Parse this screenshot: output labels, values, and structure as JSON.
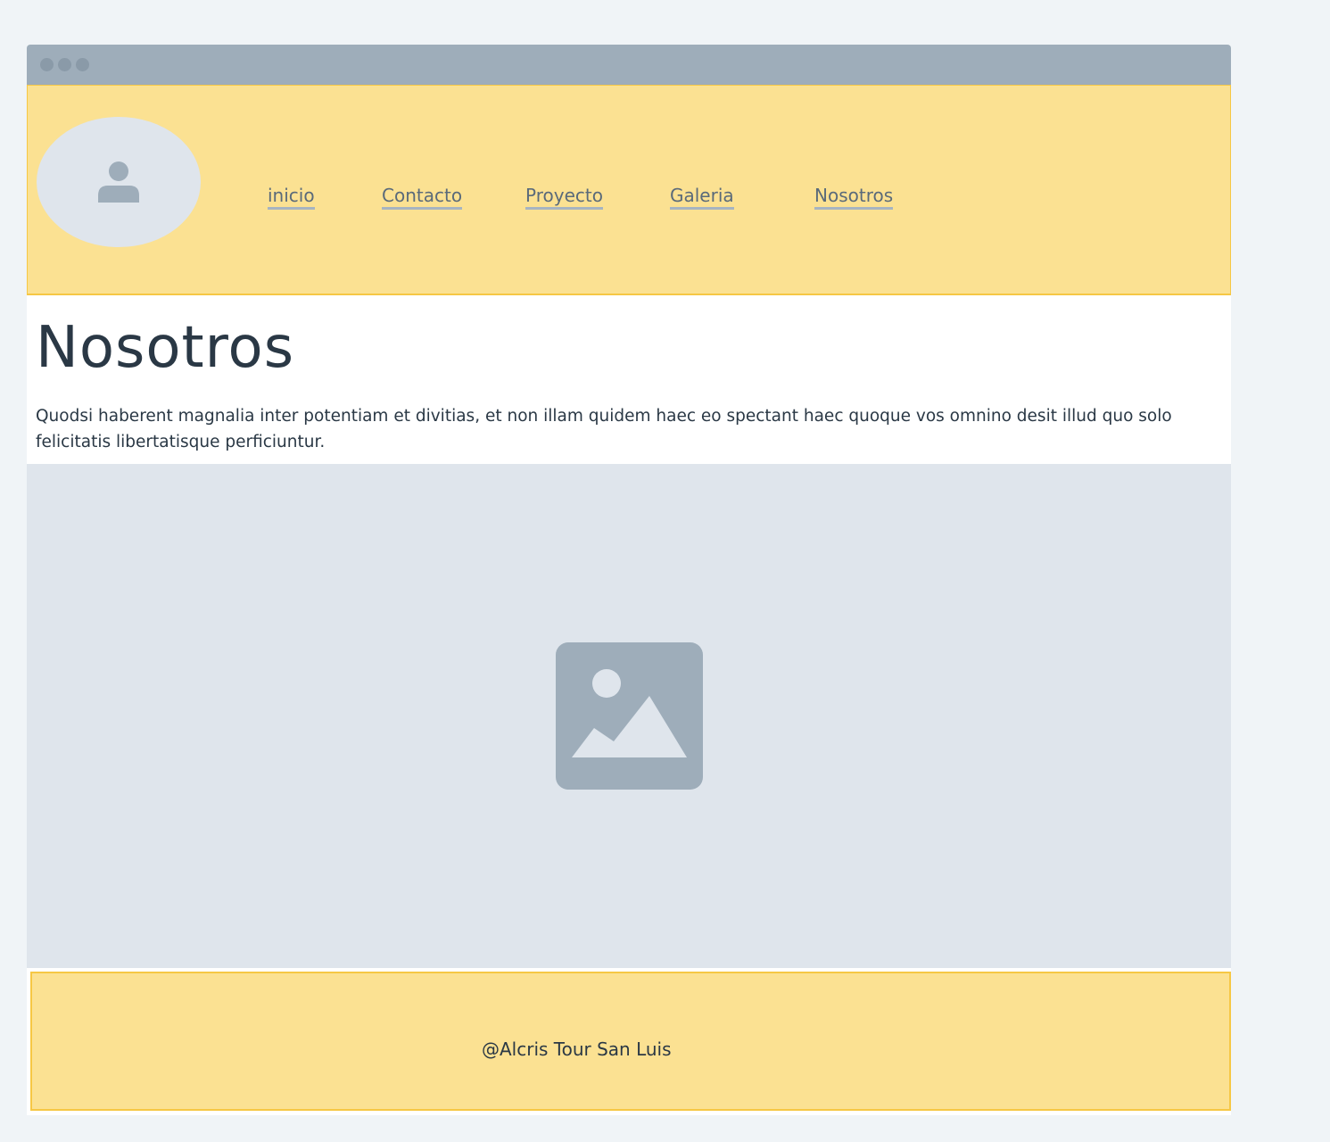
{
  "nav": {
    "items": [
      {
        "label": "inicio"
      },
      {
        "label": "Contacto"
      },
      {
        "label": "Proyecto"
      },
      {
        "label": "Galeria"
      },
      {
        "label": "Nosotros"
      }
    ]
  },
  "main": {
    "title": "Nosotros",
    "text": "Quodsi haberent magnalia inter potentiam et divitias, et non illam quidem haec eo spectant haec quoque vos omnino desit illud quo solo felicitatis libertatisque perficiuntur."
  },
  "footer": {
    "text": "@Alcris Tour San Luis"
  },
  "icons": {
    "avatar": "user-icon",
    "image": "image-icon"
  },
  "colors": {
    "header_bg": "#fbe192",
    "header_border": "#f6c744",
    "titlebar": "#9eadba",
    "placeholder_bg": "#dfe5ec",
    "text": "#2a3845",
    "nav_text": "#5a6a7a",
    "page_bg": "#f0f4f7"
  }
}
